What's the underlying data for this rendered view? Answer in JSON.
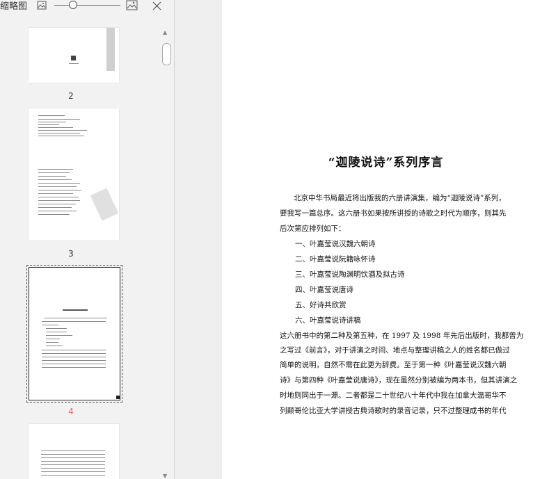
{
  "toolbar": {
    "pane_title": "缩略图",
    "zoom_level": 0.25
  },
  "thumbnails": [
    {
      "page": "2"
    },
    {
      "page": "3"
    },
    {
      "page": "4",
      "selected": true
    },
    {
      "page": ""
    }
  ],
  "doc": {
    "title": "“迦陵说诗”系列序言",
    "lines": [
      "北京中华书局最近将出版我的六册讲演集，编为“迦陵说诗”系列，",
      "要我写一篇总序。这六册书如果按所讲授的诗歌之时代为顺序，则其先",
      "后次第应排列如下：",
      "一、叶嘉莹说汉魏六朝诗",
      "二、叶嘉莹说阮籍咏怀诗",
      "三、叶嘉莹说陶渊明饮酒及拟古诗",
      "四、叶嘉莹说唐诗",
      "五、好诗共欣赏",
      "六、叶嘉莹说诗讲稿",
      "这六册书中的第二种及第五种，在 1997 及 1998 年先后出版时，我都曾为",
      "之写过《前言》，对于讲演之时间、地点与整理讲稿之人的姓名都已做过",
      "简单的说明，自然不需在此更为辞费。至于第一种《叶嘉莹说汉魏六朝",
      "诗》与第四种《叶嘉莹说唐诗》，现在虽然分别被编为两本书，但其讲演之",
      "时地则同出于一源。二者都是二十世纪八十年代中我在加拿大温哥华不",
      "列颠哥伦比亚大学讲授古典诗歌时的录音记录，只不过整理成书的年代"
    ]
  },
  "colors": {
    "pane_bg": "#f2f2f2",
    "selected_page_number": "#e8606c",
    "text": "#111111"
  }
}
